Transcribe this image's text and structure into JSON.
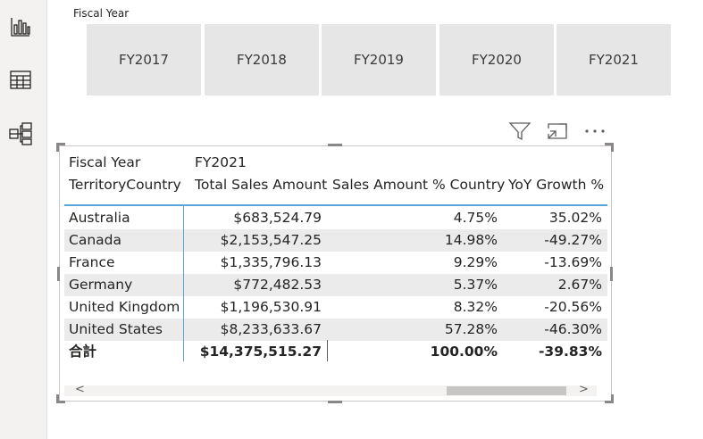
{
  "slicer": {
    "title": "Fiscal Year",
    "tiles": [
      "FY2017",
      "FY2018",
      "FY2019",
      "FY2020",
      "FY2021"
    ]
  },
  "rail": {
    "icons": [
      "report-view-icon",
      "data-view-icon",
      "model-view-icon"
    ]
  },
  "visual_header": {
    "icons": [
      "filter-icon",
      "focus-mode-icon",
      "more-options-icon"
    ]
  },
  "table": {
    "header_row1": {
      "col0": "Fiscal Year",
      "col1": "FY2021"
    },
    "header_row2": {
      "col0": "TerritoryCountry",
      "col1": "Total Sales Amount",
      "col2": "Sales Amount % Country",
      "col3": "YoY Growth %"
    },
    "rows": [
      {
        "country": "Australia",
        "sales": "$683,524.79",
        "pct": "4.75%",
        "yoy": "35.02%"
      },
      {
        "country": "Canada",
        "sales": "$2,153,547.25",
        "pct": "14.98%",
        "yoy": "-49.27%"
      },
      {
        "country": "France",
        "sales": "$1,335,796.13",
        "pct": "9.29%",
        "yoy": "-13.69%"
      },
      {
        "country": "Germany",
        "sales": "$772,482.53",
        "pct": "5.37%",
        "yoy": "2.67%"
      },
      {
        "country": "United Kingdom",
        "sales": "$1,196,530.91",
        "pct": "8.32%",
        "yoy": "-20.56%"
      },
      {
        "country": "United States",
        "sales": "$8,233,633.67",
        "pct": "57.28%",
        "yoy": "-46.30%"
      }
    ],
    "total": {
      "label": "合計",
      "sales": "$14,375,515.27",
      "pct": "100.00%",
      "yoy": "-39.83%"
    }
  },
  "scrollbar": {
    "left_arrow": "<",
    "right_arrow": ">"
  },
  "colors": {
    "accent": "#5ba3d9",
    "tile_bg": "#e6e6e6",
    "stripe": "#ebebeb"
  }
}
